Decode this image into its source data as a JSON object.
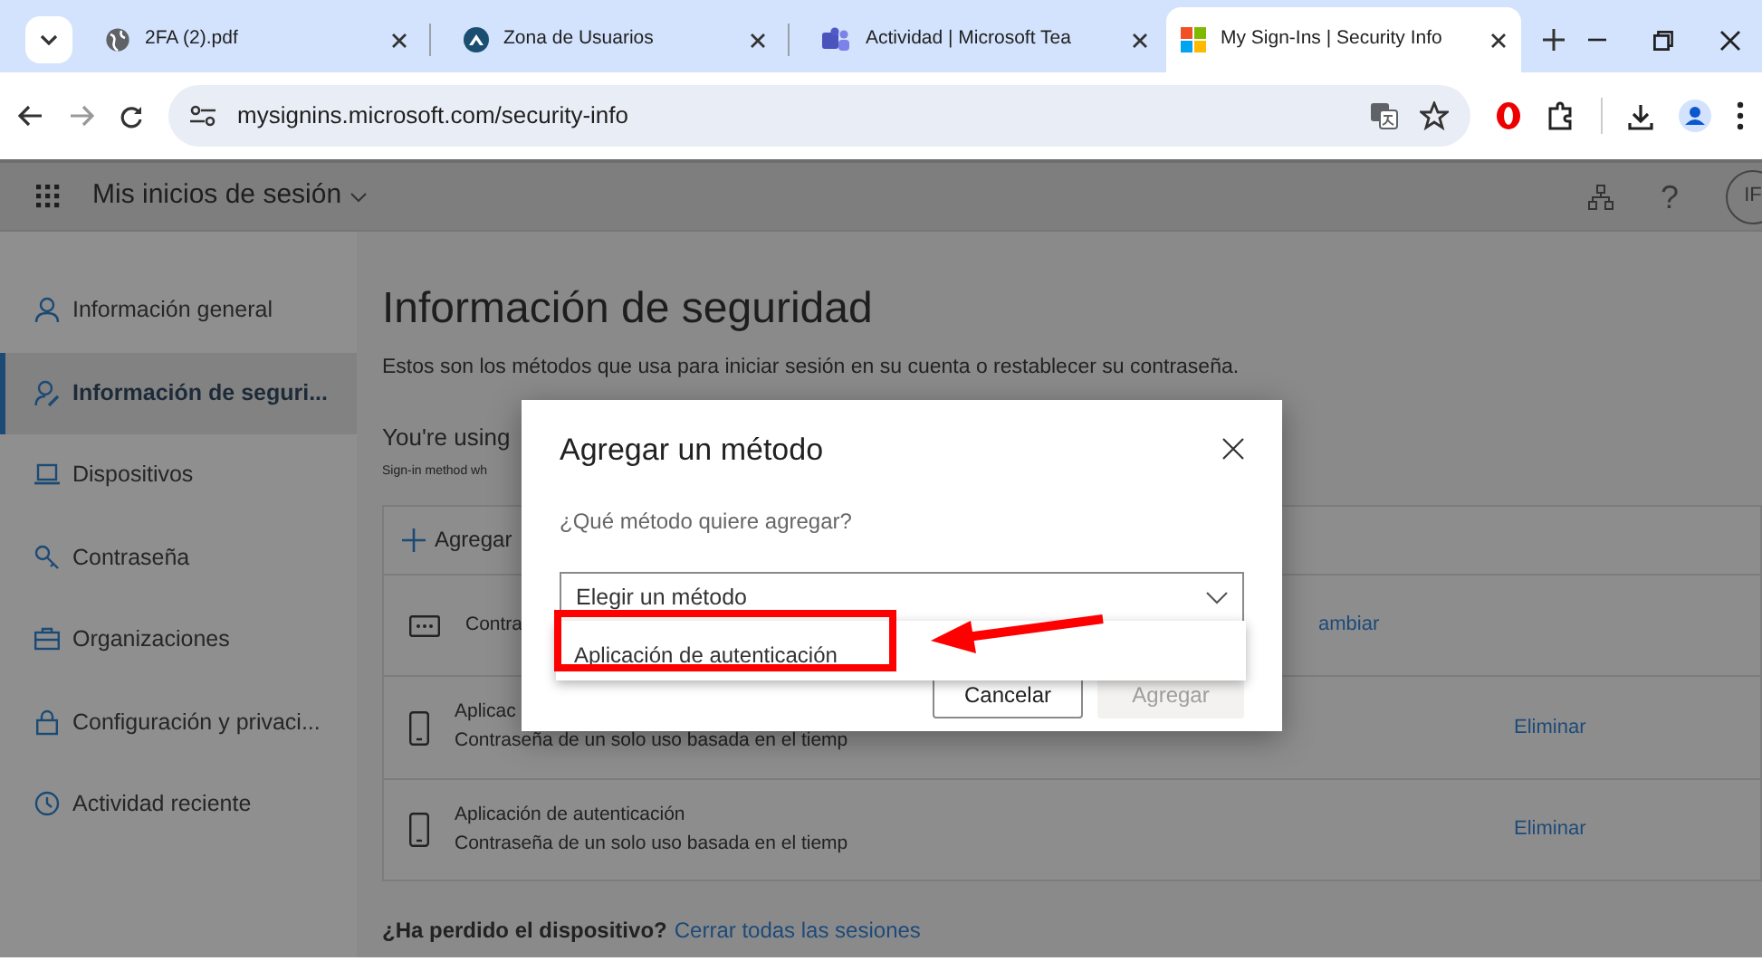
{
  "browser": {
    "tabs": [
      {
        "kind": "globe",
        "title": "2FA (2).pdf",
        "selected": false
      },
      {
        "kind": "logo",
        "title": "Zona de Usuarios",
        "selected": false
      },
      {
        "kind": "teams",
        "title": "Actividad | Microsoft Tea",
        "selected": false
      },
      {
        "kind": "microsoft",
        "title": "My Sign-Ins | Security Info",
        "selected": true
      }
    ],
    "address": "mysignins.microsoft.com/security-info"
  },
  "app": {
    "title": "Mis inicios de sesión",
    "avatar": "IF",
    "help": "?"
  },
  "sidebar": {
    "items": [
      {
        "kind": "person",
        "label": "Información general",
        "selected": false
      },
      {
        "kind": "person-edit",
        "label": "Información de seguri...",
        "selected": true
      },
      {
        "kind": "laptop",
        "label": "Dispositivos",
        "selected": false
      },
      {
        "kind": "key",
        "label": "Contraseña",
        "selected": false
      },
      {
        "kind": "briefcase",
        "label": "Organizaciones",
        "selected": false
      },
      {
        "kind": "lock",
        "label": "Configuración y privaci...",
        "selected": false
      },
      {
        "kind": "history",
        "label": "Actividad reciente",
        "selected": false
      }
    ]
  },
  "main": {
    "title": "Información de seguridad",
    "subtitle": "Estos son los métodos que usa para iniciar sesión en su cuenta o restablecer su contraseña.",
    "notice_title": "You're using",
    "notice_text": "Sign-in method wh",
    "add_label": "Agregar",
    "methods": [
      {
        "kind": "password",
        "line1": "Contra",
        "action": "ambiar"
      },
      {
        "kind": "phone",
        "line1": "Aplicac",
        "line2": "Contraseña de un solo uso basada en el tiemp",
        "action": "Eliminar"
      },
      {
        "kind": "phone",
        "line1": "Aplicación de autenticación",
        "line2": "Contraseña de un solo uso basada en el tiemp",
        "action": "Eliminar"
      }
    ],
    "lost_question": "¿Ha perdido el dispositivo?",
    "lost_link": "Cerrar todas las sesiones"
  },
  "dialog": {
    "title": "Agregar un método",
    "prompt": "¿Qué método quiere agregar?",
    "placeholder": "Elegir un método",
    "options": [
      "Aplicación de autenticación"
    ],
    "buttons": [
      {
        "label": "Cancelar",
        "disabled": false
      },
      {
        "label": "Agregar",
        "disabled": true
      }
    ]
  }
}
